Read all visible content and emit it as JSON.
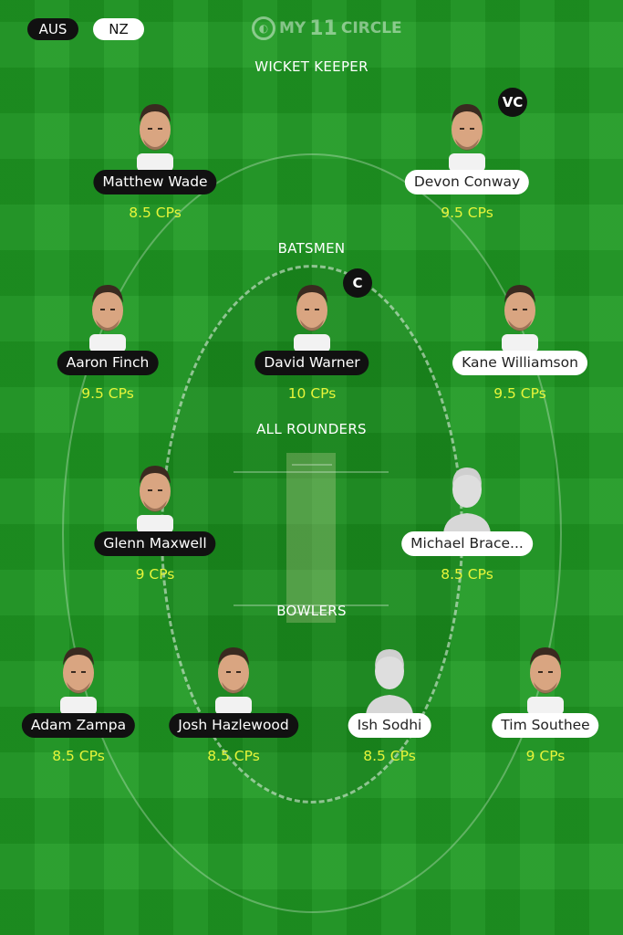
{
  "teams": {
    "team1": "AUS",
    "team2": "NZ"
  },
  "brand": {
    "logo_prefix": "MY",
    "logo_number": "11",
    "logo_suffix": "CIRCLE"
  },
  "sections": {
    "wicket_keeper": "WICKET KEEPER",
    "batsmen": "BATSMEN",
    "all_rounders": "ALL ROUNDERS",
    "bowlers": "BOWLERS"
  },
  "colors": {
    "field": "#1f9a23",
    "points": "#e6f53a",
    "aus_pill": "#111111",
    "nz_pill": "#ffffff"
  },
  "players": [
    {
      "key": "matthew-wade",
      "name": "Matthew Wade",
      "points": "8.5 CPs",
      "team": "aus",
      "role_badge": "",
      "photo": "player-photo"
    },
    {
      "key": "devon-conway",
      "name": "Devon Conway",
      "points": "9.5 CPs",
      "team": "nz",
      "role_badge": "VC",
      "photo": "player-photo"
    },
    {
      "key": "aaron-finch",
      "name": "Aaron Finch",
      "points": "9.5 CPs",
      "team": "aus",
      "role_badge": "",
      "photo": "player-photo"
    },
    {
      "key": "david-warner",
      "name": "David Warner",
      "points": "10 CPs",
      "team": "aus",
      "role_badge": "C",
      "photo": "player-photo"
    },
    {
      "key": "kane-williamson",
      "name": "Kane Williamson",
      "points": "9.5 CPs",
      "team": "nz",
      "role_badge": "",
      "photo": "player-photo"
    },
    {
      "key": "glenn-maxwell",
      "name": "Glenn Maxwell",
      "points": "9 CPs",
      "team": "aus",
      "role_badge": "",
      "photo": "player-photo"
    },
    {
      "key": "michael-bracewell",
      "name": "Michael Brace...",
      "points": "8.5 CPs",
      "team": "nz",
      "role_badge": "",
      "photo": "placeholder-avatar"
    },
    {
      "key": "adam-zampa",
      "name": "Adam Zampa",
      "points": "8.5 CPs",
      "team": "aus",
      "role_badge": "",
      "photo": "player-photo"
    },
    {
      "key": "josh-hazlewood",
      "name": "Josh Hazlewood",
      "points": "8.5 CPs",
      "team": "aus",
      "role_badge": "",
      "photo": "player-photo"
    },
    {
      "key": "ish-sodhi",
      "name": "Ish Sodhi",
      "points": "8.5 CPs",
      "team": "nz",
      "role_badge": "",
      "photo": "placeholder-avatar"
    },
    {
      "key": "tim-southee",
      "name": "Tim Southee",
      "points": "9 CPs",
      "team": "nz",
      "role_badge": "",
      "photo": "player-photo"
    }
  ]
}
